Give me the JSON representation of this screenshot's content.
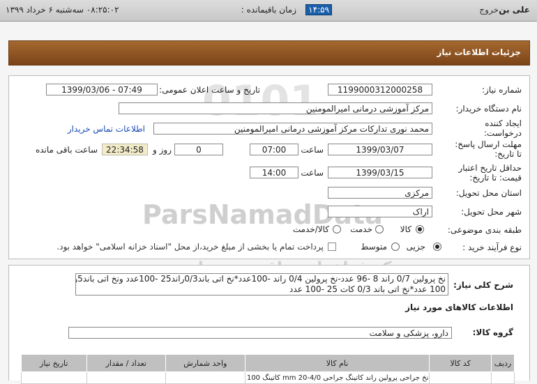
{
  "topbar": {
    "user": "علی بن",
    "logout": "خروج",
    "remaining_label": "زمان باقیمانده :",
    "remaining_time": "۱۴:۵۹",
    "datetime": "۰۸:۲۵:۰۲   سه‌شنبه ۶ خرداد ۱۳۹۹"
  },
  "watermark": {
    "brand": "ParsNamadData",
    "sub": "مرکز فراخوان مناقصه و مزایده",
    "phone": "۰۲۱-۸۸۳۴۹۶۷۰-۵"
  },
  "header": {
    "title": "جزئیات اطلاعات نیاز"
  },
  "form": {
    "need_number_label": "شماره نیاز:",
    "need_number": "1199000312000258",
    "announce_label": "تاریخ و ساعت اعلان عمومی:",
    "announce_value": "1399/03/06 - 07:49",
    "buyer_label": "نام دستگاه خریدار:",
    "buyer_value": "مرکز آموزشی درمانی امیرالمومنین",
    "creator_label_1": "ایجاد کننده",
    "creator_label_2": "درخواست:",
    "creator_value": "محمد نوری تدارکات مرکز آموزشی درمانی امیرالمومنین",
    "contact_link": "اطلاعات تماس خریدار",
    "deadline_label_1": "مهلت ارسال پاسخ:",
    "deadline_label_2": "تا تاریخ:",
    "deadline_date": "1399/03/07",
    "time_label": "ساعت",
    "deadline_time": "07:00",
    "days_value": "0",
    "days_label": "روز و",
    "remain_value": "22:34:58",
    "remain_label": "ساعت باقی مانده",
    "validity_label_1": "حداقل تاریخ اعتبار",
    "validity_label_2": "قیمت: تا تاریخ:",
    "validity_date": "1399/03/15",
    "validity_time": "14:00",
    "province_label": "استان محل تحویل:",
    "province_value": "مرکزی",
    "city_label": "شهر محل تحویل:",
    "city_value": "اراک",
    "category_label": "طبقه بندی موضوعی:",
    "category_options": [
      "کالا",
      "خدمت",
      "کالا/خدمت"
    ],
    "process_label": "نوع فرآیند خرید :",
    "process_options": [
      "جزیی",
      "متوسط"
    ],
    "payment_note": "پرداخت تمام یا بخشی از مبلغ خرید،از محل \"اسناد خزانه اسلامی\" خواهد بود."
  },
  "description": {
    "label": "شرح کلی نیاز:",
    "line1": "نخ پرولین 0/7 راند 8 -96 عدد-نخ پرولین 0/4 راند -100عدد*نخ اتی باند0/3راند25 -100عدد ونخ اتی باند5راند",
    "line2": "100 عدد*نخ اتی باند 0/3 کات  25 -100 عدد"
  },
  "goods": {
    "title": "اطلاعات کالاهای مورد نیاز",
    "group_label": "گروه کالا:",
    "group_value": "دارو، پزشکی و سلامت",
    "columns": [
      "ردیف",
      "کد کالا",
      "نام کالا",
      "واحد شمارش",
      "تعداد / مقدار",
      "تاریخ نیاز"
    ],
    "row_partial": "نخ جراحی پرولین راند کاتینگ جراحی mm 20-4/0 کاتینگ 100"
  }
}
